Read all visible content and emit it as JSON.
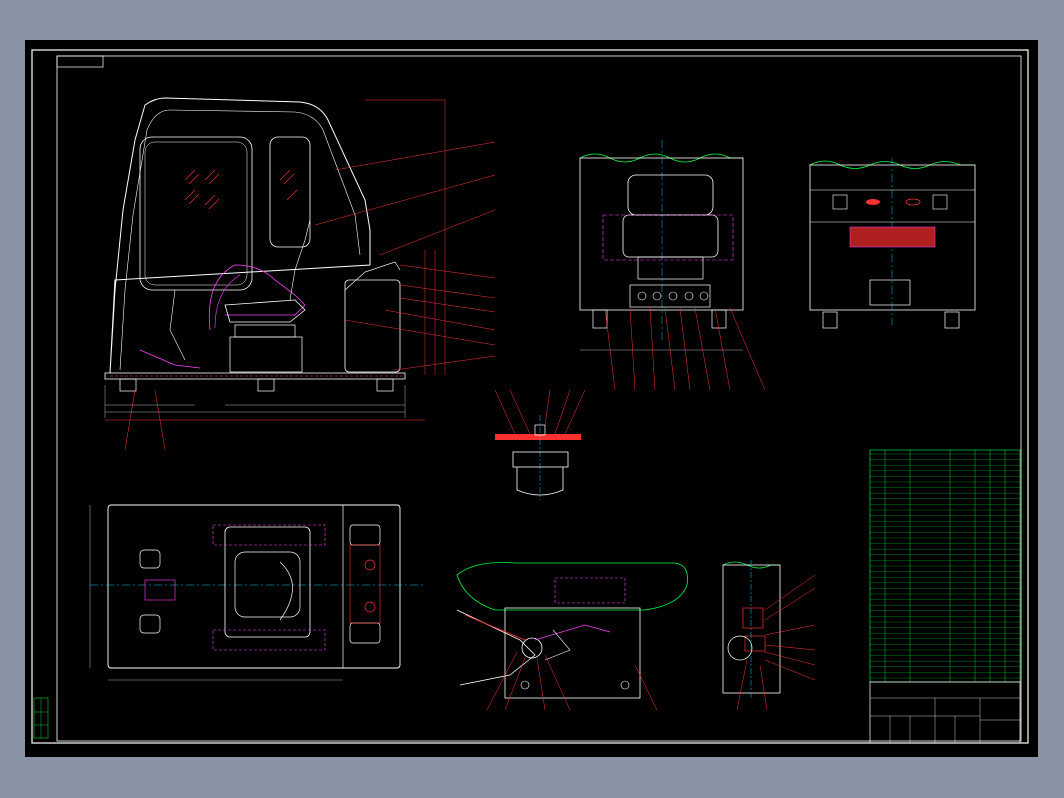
{
  "drawing": {
    "colors": {
      "background": "#000000",
      "outline": "#ffffff",
      "leader": "#ff2020",
      "center": "#00c8ff",
      "hidden": "#ff40ff",
      "terrain": "#00ff40",
      "dims": "#e0e0e0",
      "table": "#00ff40"
    },
    "title_block": {
      "drawing_no": "",
      "sheet": ""
    }
  }
}
